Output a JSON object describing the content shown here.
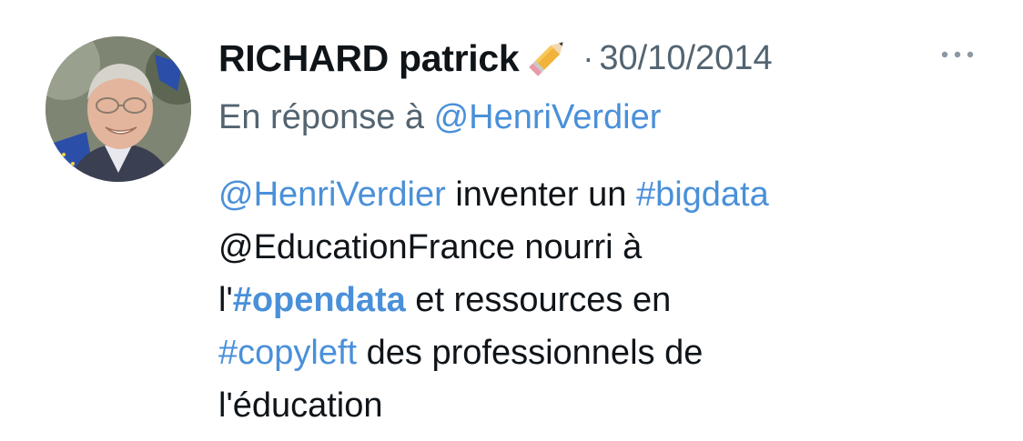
{
  "author": {
    "name": "RICHARD patrick",
    "name_emoji": "pencil-icon"
  },
  "meta": {
    "separator": "·",
    "date": "30/10/2014",
    "more_icon": "more-horizontal-icon"
  },
  "reply": {
    "prefix": "En réponse à ",
    "handle": "@HenriVerdier"
  },
  "text": {
    "mention_1": "@HenriVerdier",
    "t1": " inventer un ",
    "hashtag_1": "#bigdata",
    "t2": "@EducationFrance nourri à",
    "t3": "l'",
    "hashtag_2": "#opendata",
    "t4": " et ressources en",
    "hashtag_3": "#copyleft",
    "t5": " des professionnels de",
    "t6": "l'éducation"
  },
  "colors": {
    "link": "#4a90d9",
    "muted": "#536471",
    "text": "#0f1419"
  }
}
